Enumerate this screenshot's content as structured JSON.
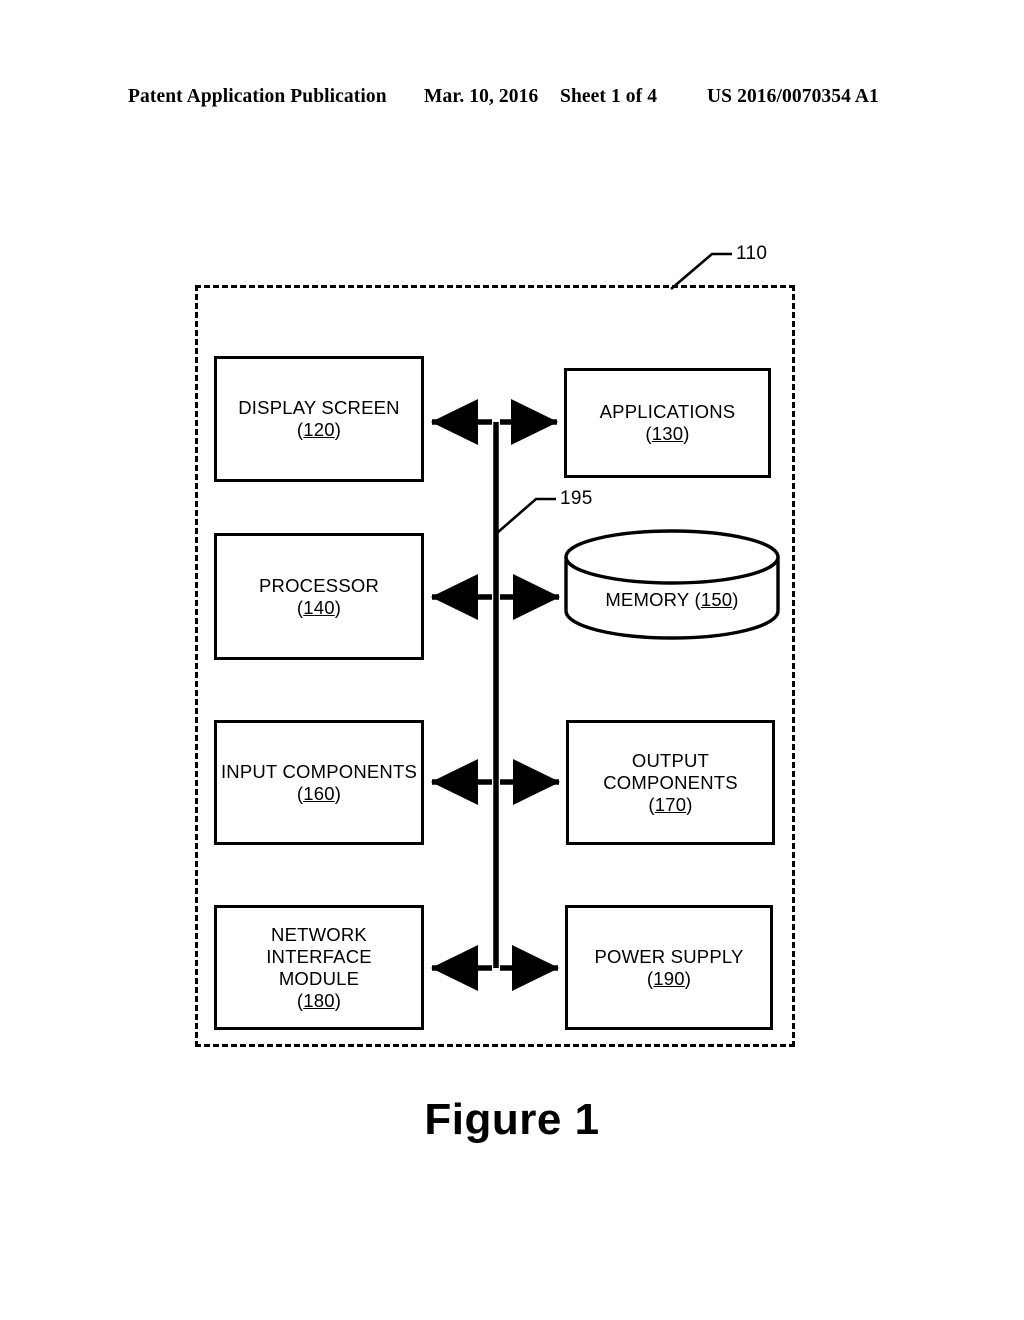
{
  "page_header": {
    "publication": "Patent Application Publication",
    "date": "Mar. 10, 2016",
    "sheet": "Sheet 1 of 4",
    "patent_number": "US 2016/0070354 A1"
  },
  "figure": {
    "caption": "Figure 1",
    "device_boundary": {
      "ref": "110",
      "style": "dashed"
    },
    "bus": {
      "ref": "195",
      "description": "system bus"
    },
    "blocks": [
      {
        "id": "display-screen",
        "label": "DISPLAY SCREEN",
        "label2": "",
        "ref": "(120)",
        "shape": "rect"
      },
      {
        "id": "applications",
        "label": "APPLICATIONS",
        "label2": "",
        "ref": "(130)",
        "shape": "rect"
      },
      {
        "id": "processor",
        "label": "PROCESSOR",
        "label2": "",
        "ref": "(140)",
        "shape": "rect"
      },
      {
        "id": "memory",
        "label": "MEMORY",
        "label2": "",
        "ref": "(150)",
        "shape": "cylinder"
      },
      {
        "id": "input-components",
        "label": "INPUT COMPONENTS",
        "label2": "",
        "ref": "(160)",
        "shape": "rect"
      },
      {
        "id": "output-components",
        "label": "OUTPUT",
        "label2": "COMPONENTS",
        "ref": "(170)",
        "shape": "rect"
      },
      {
        "id": "network-interface",
        "label": "NETWORK INTERFACE",
        "label2": "MODULE",
        "ref": "(180)",
        "shape": "rect"
      },
      {
        "id": "power-supply",
        "label": "POWER SUPPLY",
        "label2": "",
        "ref": "(190)",
        "shape": "rect"
      }
    ],
    "connections": [
      {
        "from": "display-screen",
        "to": "applications",
        "type": "double-arrow"
      },
      {
        "from": "processor",
        "to": "memory",
        "type": "double-arrow"
      },
      {
        "from": "input-components",
        "to": "output-components",
        "type": "double-arrow"
      },
      {
        "from": "network-interface",
        "to": "power-supply",
        "type": "double-arrow"
      }
    ]
  },
  "colors": {
    "ink": "#000000",
    "paper": "#ffffff"
  }
}
